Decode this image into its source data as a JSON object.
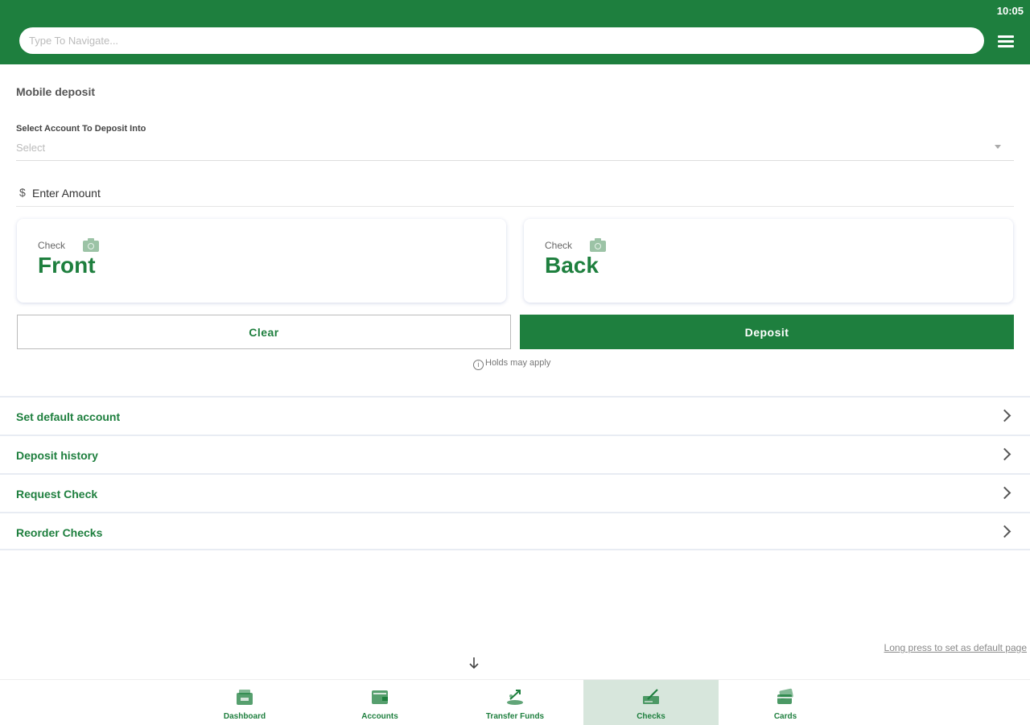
{
  "status_bar": {
    "time": "10:05"
  },
  "header": {
    "search_placeholder": "Type To Navigate..."
  },
  "page": {
    "title": "Mobile deposit"
  },
  "account_select": {
    "label": "Select Account To Deposit Into",
    "value": "Select"
  },
  "amount": {
    "currency_symbol": "$",
    "placeholder": "Enter Amount"
  },
  "check_front": {
    "small_label": "Check",
    "big_label": "Front"
  },
  "check_back": {
    "small_label": "Check",
    "big_label": "Back"
  },
  "buttons": {
    "clear": "Clear",
    "deposit": "Deposit"
  },
  "holds_note": "Holds may apply",
  "menu_items": [
    {
      "label": "Set default account"
    },
    {
      "label": "Deposit history"
    },
    {
      "label": "Request Check"
    },
    {
      "label": "Reorder Checks"
    }
  ],
  "long_press_hint": "Long press to set as default page",
  "bottom_nav": [
    {
      "label": "Dashboard",
      "icon": "dashboard-icon",
      "active": false
    },
    {
      "label": "Accounts",
      "icon": "wallet-icon",
      "active": false
    },
    {
      "label": "Transfer Funds",
      "icon": "transfer-icon",
      "active": false
    },
    {
      "label": "Checks",
      "icon": "check-pen-icon",
      "active": true
    },
    {
      "label": "Cards",
      "icon": "cards-icon",
      "active": false
    }
  ],
  "colors": {
    "brand_green": "#1e7f3e",
    "active_tab_bg": "#d7e6dc"
  }
}
